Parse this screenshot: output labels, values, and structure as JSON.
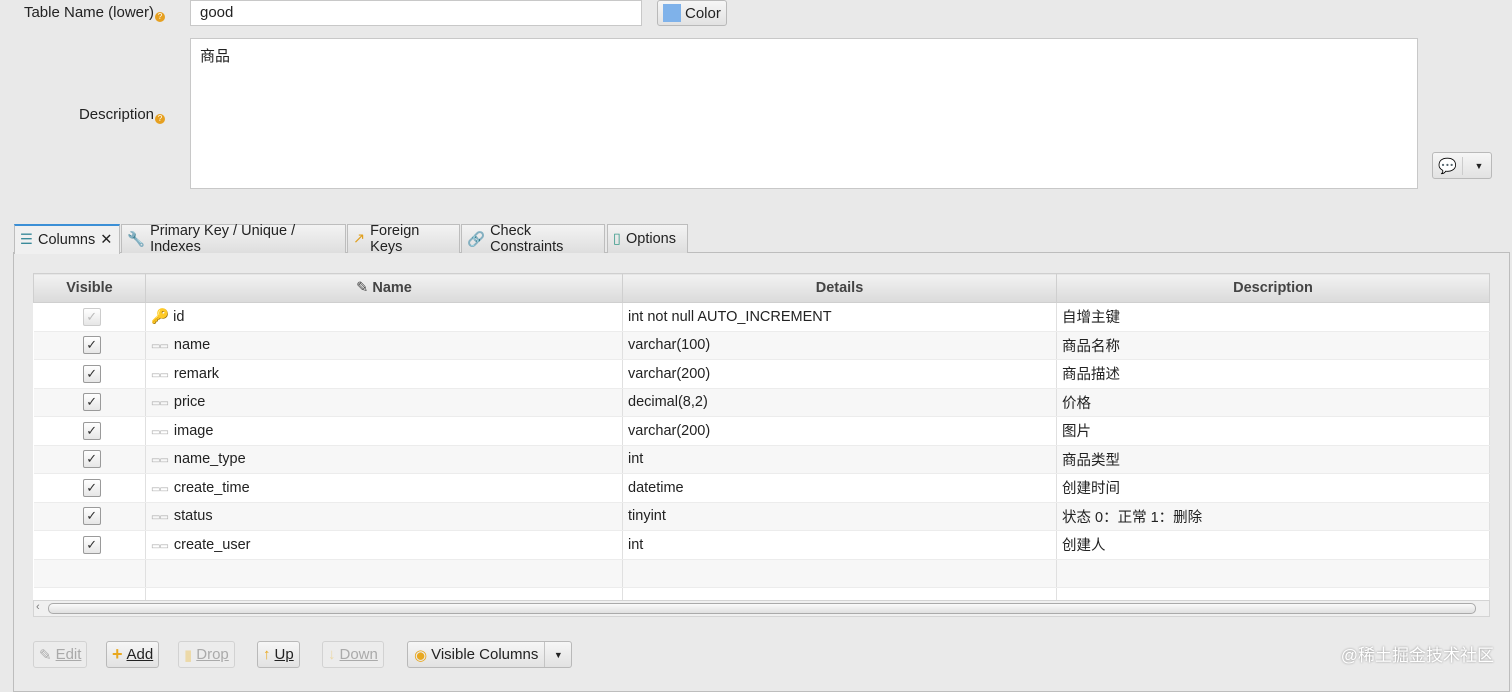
{
  "form": {
    "table_name_label": "Table Name (lower)",
    "table_name_value": "good",
    "color_button": "Color",
    "color_swatch": "#7fb2ea",
    "description_label": "Description",
    "description_value": "商品"
  },
  "tabs": [
    {
      "label": "Columns",
      "icon": "list-icon"
    },
    {
      "label": "Primary Key / Unique / Indexes",
      "icon": "key-icon"
    },
    {
      "label": "Foreign Keys",
      "icon": "arrow-icon"
    },
    {
      "label": "Check Constraints",
      "icon": "link-icon"
    },
    {
      "label": "Options",
      "icon": "options-icon"
    }
  ],
  "table": {
    "headers": [
      "Visible",
      "Name",
      "Details",
      "Description"
    ],
    "rows": [
      {
        "visible": true,
        "pk": true,
        "name": "id",
        "details": "int not null AUTO_INCREMENT",
        "description": "自增主键"
      },
      {
        "visible": true,
        "name": "name",
        "details": "varchar(100)",
        "description": "商品名称"
      },
      {
        "visible": true,
        "name": "remark",
        "details": "varchar(200)",
        "description": "商品描述"
      },
      {
        "visible": true,
        "name": "price",
        "details": "decimal(8,2)",
        "description": "价格"
      },
      {
        "visible": true,
        "name": "image",
        "details": "varchar(200)",
        "description": "图片"
      },
      {
        "visible": true,
        "name": "name_type",
        "details": "int",
        "description": "商品类型"
      },
      {
        "visible": true,
        "name": "create_time",
        "details": "datetime",
        "description": "创建时间"
      },
      {
        "visible": true,
        "name": "status",
        "details": "tinyint",
        "description": "状态 0：正常 1：删除"
      },
      {
        "visible": true,
        "name": "create_user",
        "details": "int",
        "description": "创建人"
      }
    ]
  },
  "buttons": {
    "edit": "Edit",
    "add": "Add",
    "drop": "Drop",
    "up": "Up",
    "down": "Down",
    "visible_columns": "Visible Columns"
  },
  "watermark": "@稀土掘金技术社区"
}
